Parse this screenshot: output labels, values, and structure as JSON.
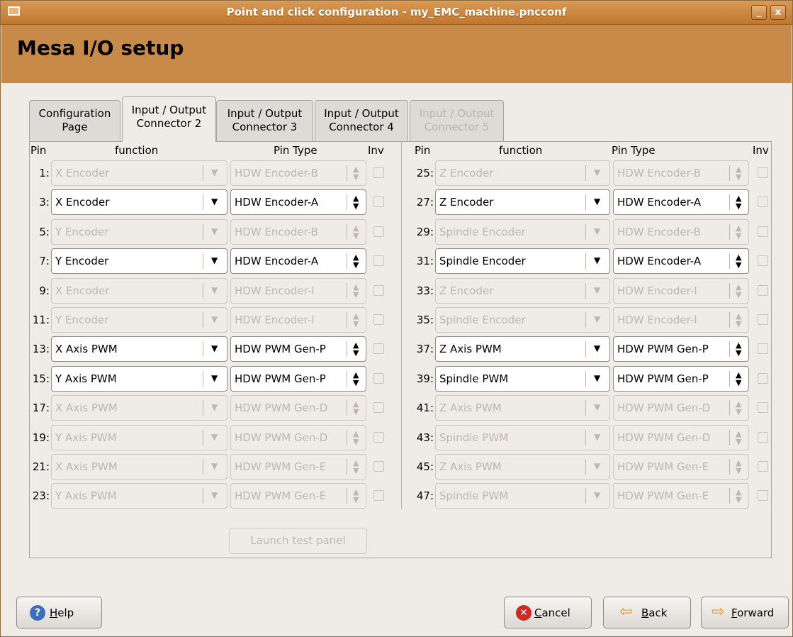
{
  "window": {
    "title": "Point and click configuration - my_EMC_machine.pncconf",
    "minimize": "_",
    "close": "x"
  },
  "page": {
    "heading": "Mesa I/O setup"
  },
  "tabs": [
    {
      "line1": "Configuration",
      "line2": "Page",
      "state": "normal"
    },
    {
      "line1": "Input / Output",
      "line2": "Connector 2",
      "state": "active"
    },
    {
      "line1": "Input / Output",
      "line2": "Connector 3",
      "state": "normal"
    },
    {
      "line1": "Input / Output",
      "line2": "Connector 4",
      "state": "normal"
    },
    {
      "line1": "Input / Output",
      "line2": "Connector 5",
      "state": "disabled"
    }
  ],
  "columns": {
    "left": {
      "pin": "Pin",
      "function": "function",
      "pintype": "Pin Type",
      "inv": "Inv"
    },
    "right": {
      "pin": "Pin",
      "function": "function",
      "pintype": "Pin Type",
      "inv": "Inv"
    }
  },
  "left_rows": [
    {
      "pin": "1:",
      "function": "X Encoder",
      "pintype": "HDW Encoder-B",
      "enabled": false
    },
    {
      "pin": "3:",
      "function": "X Encoder",
      "pintype": "HDW Encoder-A",
      "enabled": true
    },
    {
      "pin": "5:",
      "function": "Y Encoder",
      "pintype": "HDW Encoder-B",
      "enabled": false
    },
    {
      "pin": "7:",
      "function": "Y Encoder",
      "pintype": "HDW Encoder-A",
      "enabled": true
    },
    {
      "pin": "9:",
      "function": "X Encoder",
      "pintype": "HDW Encoder-I",
      "enabled": false
    },
    {
      "pin": "11:",
      "function": "Y Encoder",
      "pintype": "HDW Encoder-I",
      "enabled": false
    },
    {
      "pin": "13:",
      "function": "X Axis PWM",
      "pintype": "HDW PWM Gen-P",
      "enabled": true
    },
    {
      "pin": "15:",
      "function": "Y Axis PWM",
      "pintype": "HDW PWM Gen-P",
      "enabled": true
    },
    {
      "pin": "17:",
      "function": "X Axis PWM",
      "pintype": "HDW PWM Gen-D",
      "enabled": false
    },
    {
      "pin": "19:",
      "function": "Y Axis PWM",
      "pintype": "HDW PWM Gen-D",
      "enabled": false
    },
    {
      "pin": "21:",
      "function": "X Axis PWM",
      "pintype": "HDW PWM Gen-E",
      "enabled": false
    },
    {
      "pin": "23:",
      "function": "Y Axis PWM",
      "pintype": "HDW PWM Gen-E",
      "enabled": false
    }
  ],
  "right_rows": [
    {
      "pin": "25:",
      "function": "Z Encoder",
      "pintype": "HDW Encoder-B",
      "enabled": false
    },
    {
      "pin": "27:",
      "function": "Z Encoder",
      "pintype": "HDW Encoder-A",
      "enabled": true
    },
    {
      "pin": "29:",
      "function": "Spindle Encoder",
      "pintype": "HDW Encoder-B",
      "enabled": false
    },
    {
      "pin": "31:",
      "function": "Spindle Encoder",
      "pintype": "HDW Encoder-A",
      "enabled": true
    },
    {
      "pin": "33:",
      "function": "Z Encoder",
      "pintype": "HDW Encoder-I",
      "enabled": false
    },
    {
      "pin": "35:",
      "function": "Spindle Encoder",
      "pintype": "HDW Encoder-I",
      "enabled": false
    },
    {
      "pin": "37:",
      "function": "Z Axis PWM",
      "pintype": "HDW PWM Gen-P",
      "enabled": true
    },
    {
      "pin": "39:",
      "function": "Spindle PWM",
      "pintype": "HDW PWM Gen-P",
      "enabled": true
    },
    {
      "pin": "41:",
      "function": "Z Axis PWM",
      "pintype": "HDW PWM Gen-D",
      "enabled": false
    },
    {
      "pin": "43:",
      "function": "Spindle PWM",
      "pintype": "HDW PWM Gen-D",
      "enabled": false
    },
    {
      "pin": "45:",
      "function": "Z Axis PWM",
      "pintype": "HDW PWM Gen-E",
      "enabled": false
    },
    {
      "pin": "47:",
      "function": "Spindle PWM",
      "pintype": "HDW PWM Gen-E",
      "enabled": false
    }
  ],
  "launch_test_panel": "Launch test panel",
  "buttons": {
    "help": {
      "mn": "H",
      "rest": "elp"
    },
    "cancel": {
      "mn": "C",
      "rest": "ancel"
    },
    "back": {
      "mn": "B",
      "rest": "ack"
    },
    "forward": {
      "mn": "F",
      "rest": "orward"
    }
  },
  "colors": {
    "titlebar": "#c0762e",
    "header": "#c88a48",
    "window_bg": "#efebe7",
    "help_icon": "#3f6fb8",
    "cancel_icon": "#cc2a22",
    "arrow_icon": "#e89a2a"
  },
  "icons": {
    "help": "help-icon",
    "cancel": "cancel-icon",
    "back": "back-arrow-icon",
    "forward": "forward-arrow-icon"
  }
}
